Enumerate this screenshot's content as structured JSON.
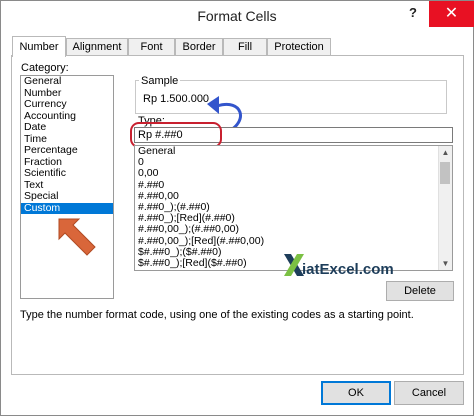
{
  "window": {
    "title": "Format Cells",
    "help": "?",
    "close": "✕"
  },
  "tabs": [
    "Number",
    "Alignment",
    "Font",
    "Border",
    "Fill",
    "Protection"
  ],
  "category": {
    "label": "Category:",
    "items": [
      "General",
      "Number",
      "Currency",
      "Accounting",
      "Date",
      "Time",
      "Percentage",
      "Fraction",
      "Scientific",
      "Text",
      "Special",
      "Custom"
    ],
    "selected": "Custom"
  },
  "sample": {
    "label": "Sample",
    "value": "Rp 1.500.000"
  },
  "type": {
    "label": "Type:",
    "value": "Rp #.##0",
    "formats": [
      "General",
      "0",
      "0,00",
      "#.##0",
      "#.##0,00",
      "#.##0_);(#.##0)",
      "#.##0_);[Red](#.##0)",
      "#.##0,00_);(#.##0,00)",
      "#.##0,00_);[Red](#.##0,00)",
      "$#.##0_);($#.##0)",
      "$#.##0_);[Red]($#.##0)"
    ]
  },
  "watermark": "iatExcel.com",
  "buttons": {
    "delete": "Delete",
    "ok": "OK",
    "cancel": "Cancel"
  },
  "description": "Type the number format code, using one of the existing codes as a starting point.",
  "colors": {
    "selection": "#0078d7",
    "annotation_red": "#c8202f",
    "annotation_blue": "#3355cc",
    "close_bg": "#e81123"
  }
}
